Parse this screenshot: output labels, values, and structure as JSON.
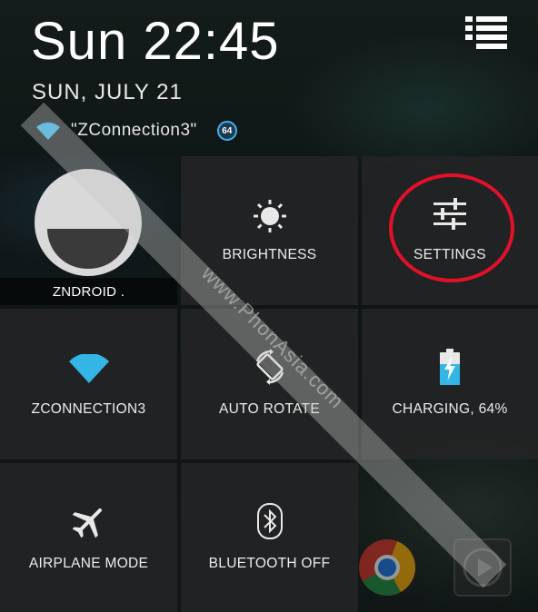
{
  "status": {
    "clock": "Sun 22:45",
    "date": "SUN, JULY 21",
    "network_name": "\"ZConnection3\"",
    "badge": "64"
  },
  "tiles": {
    "user": {
      "label": "ZNDROID .",
      "icon": "user-avatar-icon"
    },
    "brightness": {
      "label": "BRIGHTNESS",
      "icon": "sun-icon"
    },
    "settings": {
      "label": "SETTINGS",
      "icon": "sliders-icon"
    },
    "wifi": {
      "label": "ZCONNECTION3",
      "icon": "wifi-icon"
    },
    "auto_rotate": {
      "label": "AUTO ROTATE",
      "icon": "rotate-icon"
    },
    "battery": {
      "label": "CHARGING, 64%",
      "icon": "battery-charging-icon",
      "level": 64
    },
    "airplane": {
      "label": "AIRPLANE MODE",
      "icon": "airplane-icon"
    },
    "bluetooth": {
      "label": "BLUETOOTH OFF",
      "icon": "bluetooth-icon"
    }
  },
  "watermark": "www.PhonAsia.com",
  "colors": {
    "accent_blue": "#33b5e5",
    "highlight_red": "#e3102a",
    "tile_bg": "#222325"
  }
}
